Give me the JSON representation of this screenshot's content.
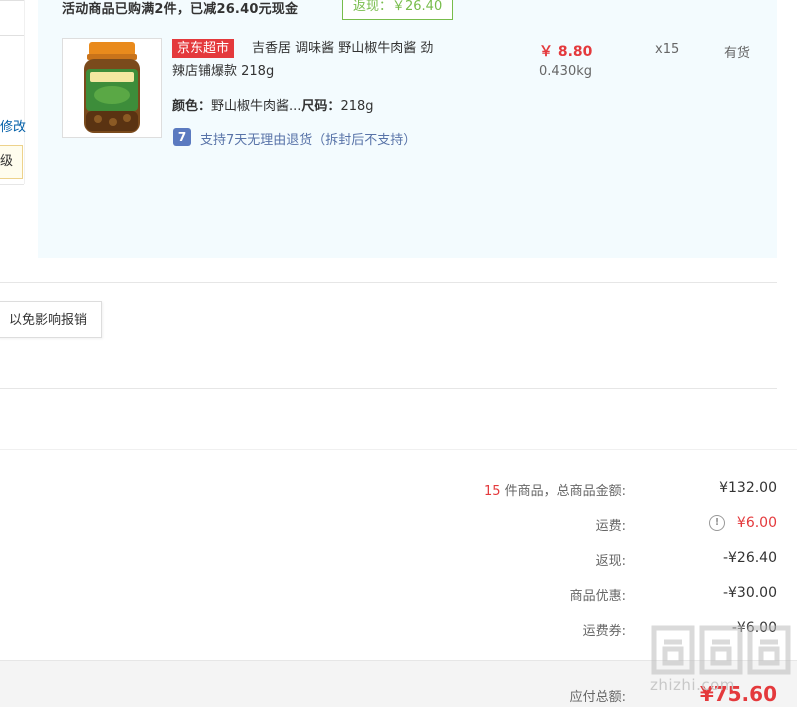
{
  "left_panel": {
    "modify_link": "修改",
    "tip_text": "级"
  },
  "promo": {
    "text": "活动商品已购满2件，已减26.40元现金",
    "rebate_tag": "返现：￥26.40"
  },
  "product": {
    "tag": "京东超市",
    "name_line1": "吉香居 调味酱 野山椒牛肉酱 劲",
    "name_line2": "辣店铺爆款 218g",
    "color_label": "颜色：",
    "color_value": "野山椒牛肉酱...",
    "size_label": "尺码：",
    "size_value": "218g",
    "service_icon": "7",
    "service_text": "支持7天无理由退货（拆封后不支持）",
    "price": "￥ 8.80",
    "weight": "0.430kg",
    "qty": "x15",
    "stock": "有货",
    "image_icon": "sauce-jar-image"
  },
  "invoice": {
    "button_text": "以免影响报销"
  },
  "summary": {
    "count": "15",
    "count_suffix": " 件商品，总商品金额:",
    "total_goods": "¥132.00",
    "shipping_label": "运费:",
    "shipping_value": "¥6.00",
    "rebate_label": "返现:",
    "rebate_value": "-¥26.40",
    "discount_label": "商品优惠:",
    "discount_value": "-¥30.00",
    "coupon_label": "运费券:",
    "coupon_value": "-¥6.00",
    "payable_label": "应付总额:",
    "payable_value": "¥75.60"
  },
  "watermark": {
    "text": "zhizhi.com"
  },
  "colors": {
    "accent_red": "#e4393c",
    "block_bg": "#f3fbfe",
    "rebate_green": "#77bc4b",
    "link_blue": "#005ea7"
  }
}
